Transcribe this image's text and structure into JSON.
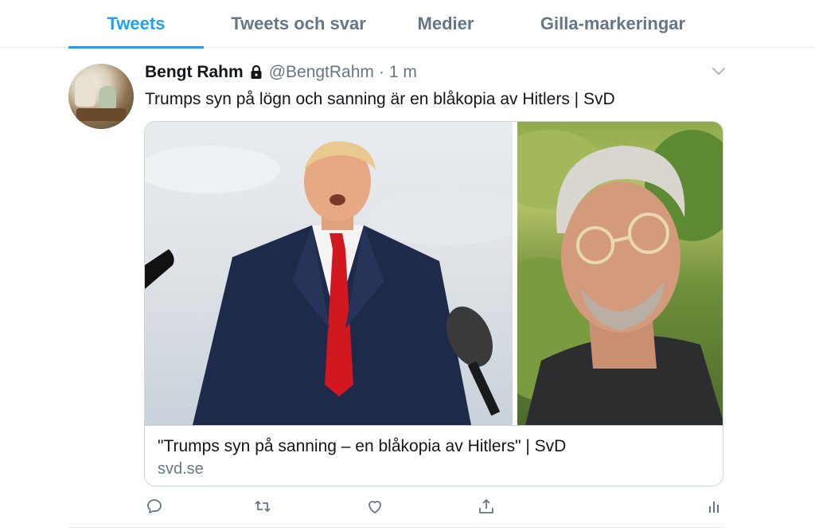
{
  "tabs": [
    {
      "label": "Tweets",
      "active": true
    },
    {
      "label": "Tweets och svar",
      "active": false
    },
    {
      "label": "Medier",
      "active": false
    },
    {
      "label": "Gilla-markeringar",
      "active": false
    }
  ],
  "tweet": {
    "name": "Bengt Rahm",
    "protected_icon": "lock-icon",
    "handle": "@BengtRahm",
    "separator": "·",
    "time": "1 m",
    "menu_icon": "chevron-down-icon",
    "text": "Trumps syn på lögn och sanning är en blåkopia av Hitlers | SvD",
    "card": {
      "title": "\"Trumps syn på sanning – en blåkopia av Hitlers\" | SvD",
      "domain": "svd.se"
    },
    "actions": [
      "reply-icon",
      "retweet-icon",
      "like-icon",
      "share-icon",
      "analytics-icon"
    ]
  },
  "colors": {
    "accent": "#1da1f2",
    "secondary_text": "#657786",
    "border": "#ccd6dd"
  }
}
